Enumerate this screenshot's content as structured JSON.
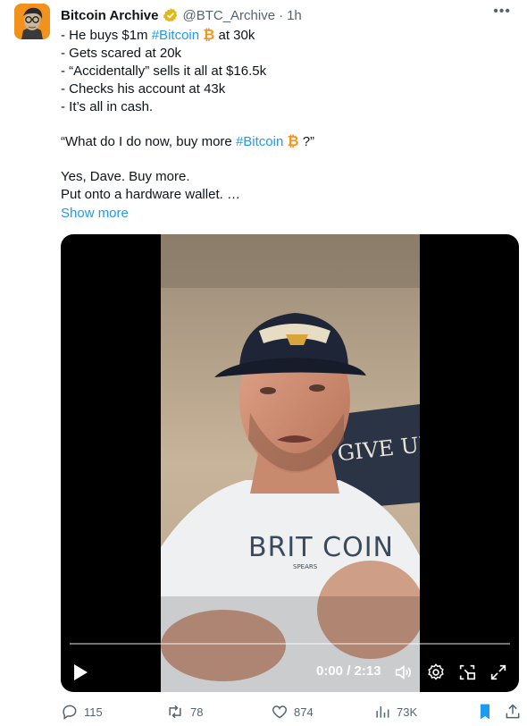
{
  "tweet": {
    "author_name": "Bitcoin Archive",
    "handle": "@BTC_Archive",
    "separator": "·",
    "time": "1h",
    "more_label": "•••",
    "lines": [
      {
        "pre": "- He buys $1m ",
        "tag": "#Bitcoin",
        "post": " at 30k"
      },
      {
        "text": "- Gets scared at 20k"
      },
      {
        "text": "- “Accidentally” sells it all at $16.5k"
      },
      {
        "text": "- Checks his account at 43k"
      },
      {
        "text": "- It’s all in cash."
      },
      {
        "pre": "“What do I do now, buy more ",
        "tag": "#Bitcoin",
        "post": " ?”"
      },
      {
        "text": "Yes, Dave.  Buy more."
      },
      {
        "text": "Put onto a hardware wallet. …"
      }
    ],
    "btc_symbol": "₿",
    "show_more": "Show more"
  },
  "video": {
    "time_display": "0:00 / 2:13",
    "progress": 0.0,
    "cap_text": "",
    "banner_text": "GIVE UP",
    "shirt_text": "BRIT COIN",
    "shirt_subtext": "SPEARS"
  },
  "actions": {
    "replies": "115",
    "reposts": "78",
    "likes": "874",
    "views": "73K"
  },
  "colors": {
    "link": "#1d9bf0",
    "btc": "#f7931a",
    "muted": "#536471",
    "bookmark": "#1d9bf0"
  },
  "icons": [
    "verified-badge-icon",
    "more-icon",
    "play-icon",
    "volume-icon",
    "settings-icon",
    "pip-icon",
    "fullscreen-icon",
    "reply-icon",
    "repost-icon",
    "like-icon",
    "views-icon",
    "bookmark-icon",
    "share-icon"
  ]
}
